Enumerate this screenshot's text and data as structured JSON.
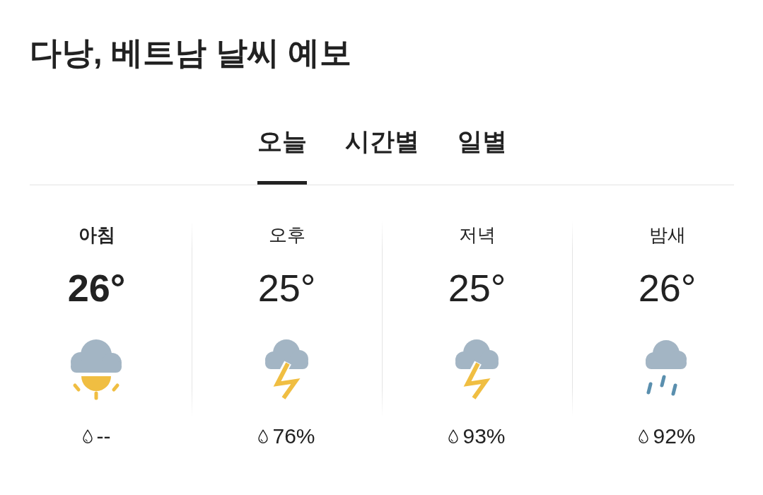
{
  "title": "다낭, 베트남 날씨 예보",
  "tabs": [
    {
      "label": "오늘",
      "selected": true
    },
    {
      "label": "시간별",
      "selected": false
    },
    {
      "label": "일별",
      "selected": false
    }
  ],
  "periods": [
    {
      "label": "아침",
      "temperature": "26°",
      "kind": "cloudsun",
      "precipitation": "--",
      "selected": true
    },
    {
      "label": "오후",
      "temperature": "25°",
      "kind": "thunderstorm",
      "precipitation": "76%",
      "selected": false
    },
    {
      "label": "저녁",
      "temperature": "25°",
      "kind": "thunderstorm",
      "precipitation": "93%",
      "selected": false
    },
    {
      "label": "밤새",
      "temperature": "26°",
      "kind": "rain",
      "precipitation": "92%",
      "selected": false
    }
  ]
}
